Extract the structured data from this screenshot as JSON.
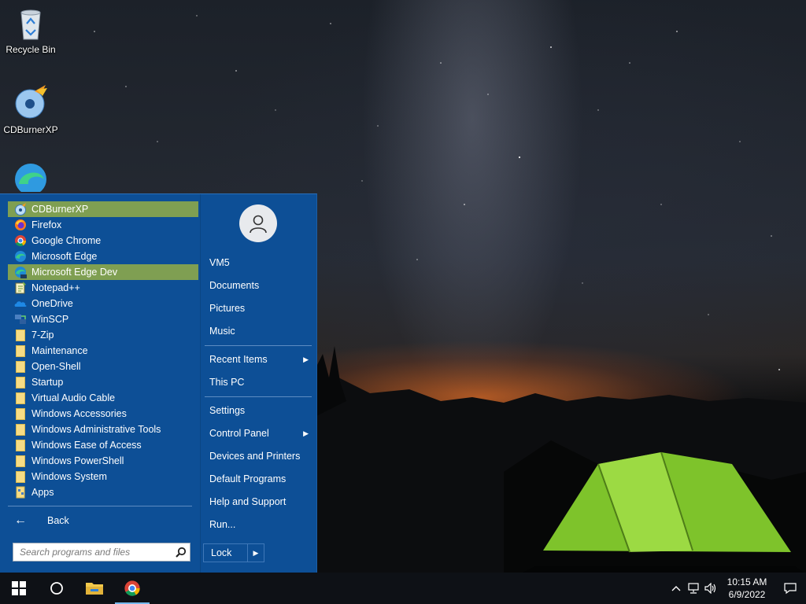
{
  "desktop": {
    "icons": [
      {
        "label": "Recycle Bin",
        "icon": "recycle-bin-icon"
      },
      {
        "label": "CDBurnerXP",
        "icon": "cdburnerxp-icon"
      },
      {
        "label": "",
        "icon": "edge-dev-icon"
      }
    ]
  },
  "start_menu": {
    "programs": [
      {
        "label": "CDBurnerXP",
        "icon": "cdburnerxp-icon",
        "highlighted": true
      },
      {
        "label": "Firefox",
        "icon": "firefox-icon"
      },
      {
        "label": "Google Chrome",
        "icon": "chrome-icon"
      },
      {
        "label": "Microsoft Edge",
        "icon": "edge-icon"
      },
      {
        "label": "Microsoft Edge Dev",
        "icon": "edge-dev-icon",
        "highlighted": true
      },
      {
        "label": "Notepad++",
        "icon": "notepadpp-icon"
      },
      {
        "label": "OneDrive",
        "icon": "onedrive-icon"
      },
      {
        "label": "WinSCP",
        "icon": "winscp-icon"
      },
      {
        "label": "7-Zip",
        "icon": "folder-icon"
      },
      {
        "label": "Maintenance",
        "icon": "folder-icon"
      },
      {
        "label": "Open-Shell",
        "icon": "folder-icon"
      },
      {
        "label": "Startup",
        "icon": "folder-icon"
      },
      {
        "label": "Virtual Audio Cable",
        "icon": "folder-icon"
      },
      {
        "label": "Windows Accessories",
        "icon": "folder-icon"
      },
      {
        "label": "Windows Administrative Tools",
        "icon": "folder-icon"
      },
      {
        "label": "Windows Ease of Access",
        "icon": "folder-icon"
      },
      {
        "label": "Windows PowerShell",
        "icon": "folder-icon"
      },
      {
        "label": "Windows System",
        "icon": "folder-icon"
      },
      {
        "label": "Apps",
        "icon": "apps-icon"
      }
    ],
    "back_label": "Back",
    "search_placeholder": "Search programs and files",
    "right_items": {
      "user": "VM5",
      "documents": "Documents",
      "pictures": "Pictures",
      "music": "Music",
      "recent_items": "Recent Items",
      "this_pc": "This PC",
      "settings": "Settings",
      "control_panel": "Control Panel",
      "devices_printers": "Devices and Printers",
      "default_programs": "Default Programs",
      "help_support": "Help and Support",
      "run": "Run..."
    },
    "lock_label": "Lock",
    "colors": {
      "menu_bg": "#0d4f96",
      "highlight": "#7f9f52"
    }
  },
  "taskbar": {
    "clock_time": "10:15 AM",
    "clock_date": "6/9/2022",
    "pinned": [
      "windows-start-icon",
      "search-circle-icon",
      "file-explorer-icon",
      "chrome-icon"
    ]
  }
}
